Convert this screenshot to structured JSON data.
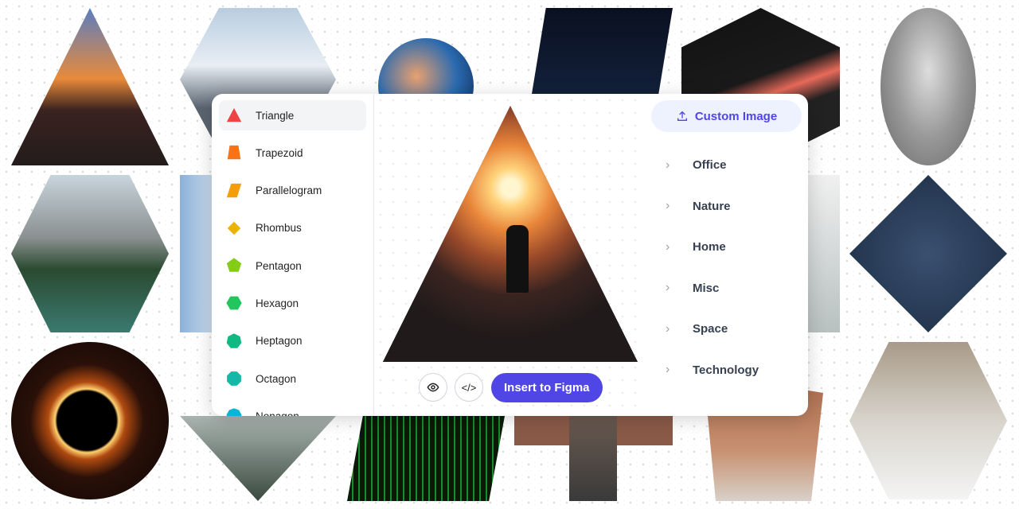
{
  "shapes": [
    {
      "label": "Triangle",
      "color": "#ef4444",
      "selected": true
    },
    {
      "label": "Trapezoid",
      "color": "#f97316"
    },
    {
      "label": "Parallelogram",
      "color": "#f59e0b"
    },
    {
      "label": "Rhombus",
      "color": "#eab308"
    },
    {
      "label": "Pentagon",
      "color": "#84cc16"
    },
    {
      "label": "Hexagon",
      "color": "#22c55e"
    },
    {
      "label": "Heptagon",
      "color": "#10b981"
    },
    {
      "label": "Octagon",
      "color": "#14b8a6"
    },
    {
      "label": "Nonagon",
      "color": "#06b6d4"
    }
  ],
  "preview": {
    "insert_label": "Insert to Figma",
    "preview_icon": "eye-icon",
    "code_icon": "code-icon"
  },
  "right": {
    "custom_label": "Custom Image",
    "categories": [
      "Office",
      "Nature",
      "Home",
      "Misc",
      "Space",
      "Technology"
    ]
  },
  "accent": "#4f46e5"
}
